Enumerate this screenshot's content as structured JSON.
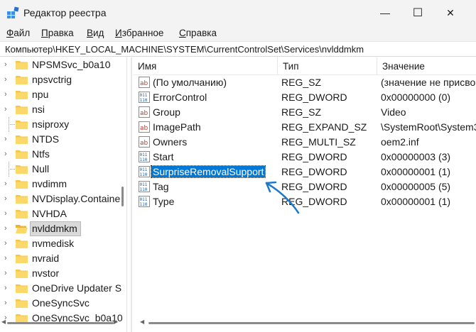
{
  "window": {
    "title": "Редактор реестра",
    "minimize_glyph": "—",
    "maximize_glyph": "☐",
    "close_glyph": "✕",
    "app_icon": "registry-icon"
  },
  "menu": {
    "items": [
      {
        "accel": "Ф",
        "rest": "айл"
      },
      {
        "accel": "П",
        "rest": "равка"
      },
      {
        "accel": "В",
        "rest": "ид"
      },
      {
        "accel": "И",
        "rest": "збранное"
      },
      {
        "accel": "С",
        "rest": "правка"
      }
    ]
  },
  "address": {
    "path": "Компьютер\\HKEY_LOCAL_MACHINE\\SYSTEM\\CurrentControlSet\\Services\\nvlddmkm"
  },
  "tree": {
    "items": [
      {
        "label": "NPSMSvc_b0a10",
        "expandable": true,
        "selected": false
      },
      {
        "label": "npsvctrig",
        "expandable": true,
        "selected": false
      },
      {
        "label": "npu",
        "expandable": true,
        "selected": false
      },
      {
        "label": "nsi",
        "expandable": true,
        "selected": false
      },
      {
        "label": "nsiproxy",
        "expandable": false,
        "selected": false
      },
      {
        "label": "NTDS",
        "expandable": true,
        "selected": false
      },
      {
        "label": "Ntfs",
        "expandable": true,
        "selected": false
      },
      {
        "label": "Null",
        "expandable": false,
        "selected": false
      },
      {
        "label": "nvdimm",
        "expandable": true,
        "selected": false
      },
      {
        "label": "NVDisplay.Containe",
        "expandable": true,
        "selected": false
      },
      {
        "label": "NVHDA",
        "expandable": true,
        "selected": false
      },
      {
        "label": "nvlddmkm",
        "expandable": true,
        "selected": true
      },
      {
        "label": "nvmedisk",
        "expandable": true,
        "selected": false
      },
      {
        "label": "nvraid",
        "expandable": true,
        "selected": false
      },
      {
        "label": "nvstor",
        "expandable": true,
        "selected": false
      },
      {
        "label": "OneDrive Updater S",
        "expandable": true,
        "selected": false
      },
      {
        "label": "OneSyncSvc",
        "expandable": true,
        "selected": false
      },
      {
        "label": "OneSyncSvc_b0a10",
        "expandable": true,
        "selected": false
      }
    ]
  },
  "columns": {
    "name": "Имя",
    "type": "Тип",
    "data": "Значение"
  },
  "values": [
    {
      "name": "(По умолчанию)",
      "type": "REG_SZ",
      "data": "(значение не присво",
      "icon": "ab",
      "selected": false
    },
    {
      "name": "ErrorControl",
      "type": "REG_DWORD",
      "data": "0x00000000 (0)",
      "icon": "bin",
      "selected": false
    },
    {
      "name": "Group",
      "type": "REG_SZ",
      "data": "Video",
      "icon": "ab",
      "selected": false
    },
    {
      "name": "ImagePath",
      "type": "REG_EXPAND_SZ",
      "data": "\\SystemRoot\\System3",
      "icon": "ab",
      "selected": false
    },
    {
      "name": "Owners",
      "type": "REG_MULTI_SZ",
      "data": "oem2.inf",
      "icon": "ab",
      "selected": false
    },
    {
      "name": "Start",
      "type": "REG_DWORD",
      "data": "0x00000003 (3)",
      "icon": "bin",
      "selected": false
    },
    {
      "name": "SurpriseRemovalSupport",
      "type": "REG_DWORD",
      "data": "0x00000001 (1)",
      "icon": "bin",
      "selected": true
    },
    {
      "name": "Tag",
      "type": "REG_DWORD",
      "data": "0x00000005 (5)",
      "icon": "bin",
      "selected": false
    },
    {
      "name": "Type",
      "type": "REG_DWORD",
      "data": "0x00000001 (1)",
      "icon": "bin",
      "selected": false
    }
  ],
  "colors": {
    "selection": "#0078d7",
    "folder": "#f6c64b",
    "annotation_arrow": "#1f78c8"
  }
}
